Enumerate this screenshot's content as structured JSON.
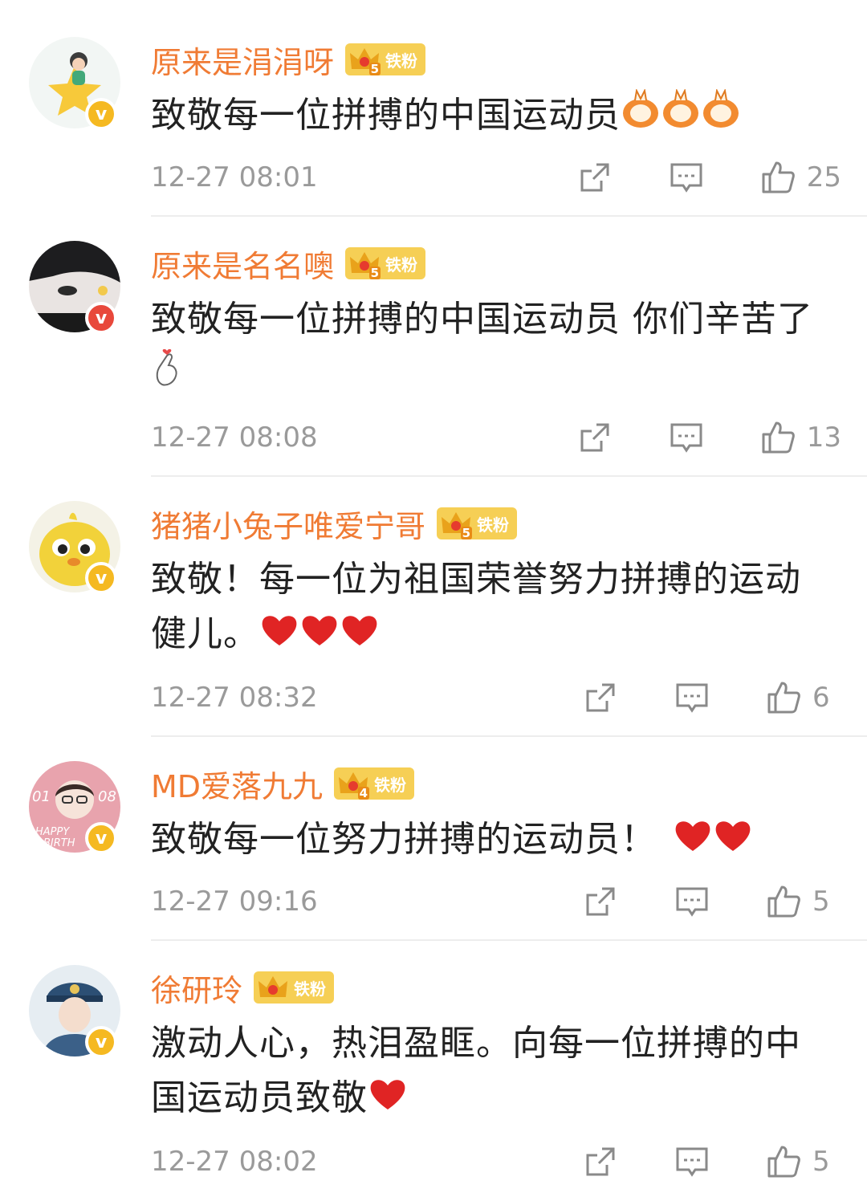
{
  "fan_badge_label": "铁粉",
  "comments": [
    {
      "username": "原来是涓涓呀",
      "fan_level": "5",
      "text": "致敬每一位拼搏的中国运动员",
      "time": "12-27 08:01",
      "likes": "25",
      "badge_color": "#f5b921"
    },
    {
      "username": "原来是名名噢",
      "fan_level": "5",
      "text": "致敬每一位拼搏的中国运动员 你们辛苦了",
      "time": "12-27 08:08",
      "likes": "13",
      "badge_color": "#e8483b"
    },
    {
      "username": "猪猪小兔子唯爱宁哥",
      "fan_level": "5",
      "text": "致敬！每一位为祖国荣誉努力拼搏的运动健儿。",
      "time": "12-27 08:32",
      "likes": "6",
      "badge_color": "#f5b921"
    },
    {
      "username": "MD爱落九九",
      "fan_level": "4",
      "text": "致敬每一位努力拼搏的运动员！",
      "time": "12-27 09:16",
      "likes": "5",
      "badge_color": "#f5b921"
    },
    {
      "username": "徐研玲",
      "fan_level": "",
      "text": "激动人心，热泪盈眶。向每一位拼搏的中国运动员致敬",
      "time": "12-27 08:02",
      "likes": "5",
      "badge_color": "#f5b921"
    }
  ],
  "avatar_4_text": [
    "01",
    "08",
    "HAPPY",
    "BIRTH"
  ],
  "icons": {
    "share": "share-icon",
    "comment": "comment-icon",
    "like": "like-icon"
  },
  "colors": {
    "username": "#f07b34",
    "fan_badge": "#f6cf55",
    "meta_text": "#9a9a9a",
    "heart": "#e02424"
  }
}
